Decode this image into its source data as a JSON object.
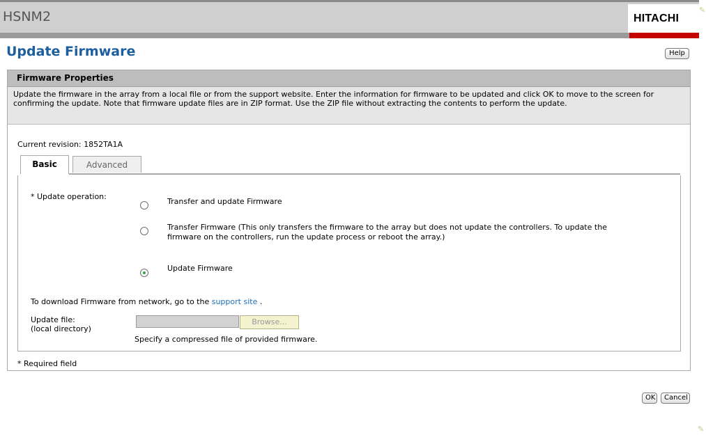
{
  "header": {
    "app_title": "HSNM2",
    "brand": "HITACHI",
    "colors": {
      "brand_red": "#c40000",
      "title_blue": "#1d5f9e",
      "link_blue": "#1d6fb8",
      "header_gray": "#cfcfcf"
    }
  },
  "page": {
    "title": "Update Firmware",
    "help_label": "Help"
  },
  "panel": {
    "title": "Firmware Properties",
    "description": "Update the firmware in the array from a local file or from the support website.  Enter the information for firmware to be updated and click OK to move to the screen for confirming the update.  Note that firmware update files are in ZIP format. Use the ZIP file without extracting the contents to perform the update.",
    "current_revision_label": "Current revision:",
    "current_revision_value": "1852TA1A"
  },
  "tabs": [
    {
      "label": "Basic",
      "selected": true
    },
    {
      "label": "Advanced",
      "selected": false
    }
  ],
  "form": {
    "operation_label": "* Update operation:",
    "options": [
      {
        "label": "Transfer and update Firmware",
        "selected": false
      },
      {
        "label": "Transfer Firmware (This only transfers the firmware to the array but does not update the controllers. To update the firmware on the controllers, run the update process or reboot the array.)",
        "selected": false
      },
      {
        "label": "Update Firmware",
        "selected": true
      }
    ],
    "download_text": "To download Firmware from network, go to the",
    "download_link": "support site",
    "download_suffix": " .",
    "update_file_label_line1": "Update file:",
    "update_file_label_line2": "(local directory)",
    "update_file_value": "",
    "browse_label": "Browse...",
    "hint": "Specify a compressed file of provided firmware.",
    "required_note": "* Required field"
  },
  "footer": {
    "ok_label": "OK",
    "cancel_label": "Cancel"
  }
}
